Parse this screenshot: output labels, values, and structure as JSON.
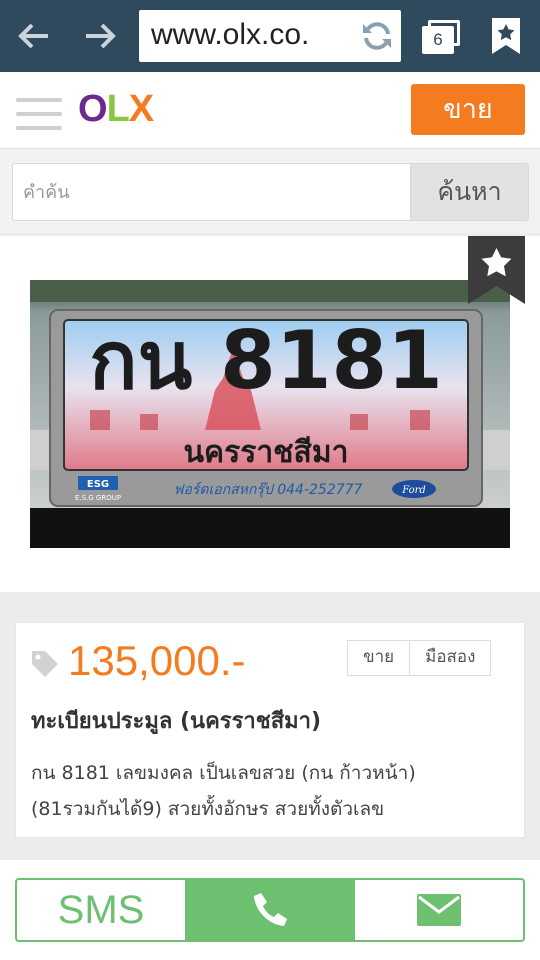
{
  "browser": {
    "url": "www.olx.co.",
    "tab_count": "6",
    "icons": [
      "back-arrow-icon",
      "forward-arrow-icon",
      "reload-icon",
      "tabs-icon",
      "bookmark-star-icon"
    ]
  },
  "header": {
    "logo": {
      "o": "O",
      "l": "L",
      "x": "X"
    },
    "sell_label": "ขาย"
  },
  "search": {
    "placeholder": "คำค้น",
    "button_label": "ค้นหา"
  },
  "listing": {
    "photo": {
      "plate_text": "กน 8181",
      "plate_province": "นครราชสีมา",
      "frame_dealer": "ฟอร์ดเอกสหกรุ๊ป 044-252777",
      "frame_tag": "ESG",
      "frame_tag_sub": "E.S.G GROUP",
      "frame_brand": "Ford"
    },
    "price": "135,000.-",
    "badges": [
      "ขาย",
      "มือสอง"
    ],
    "title": "ทะเบียนประมูล (นครราชสีมา)",
    "description_lines": [
      "กน 8181 เลขมงคล เป็นเลขสวย (กน ก้าวหน้า)",
      "(81รวมกันได้9) สวยทั้งอักษร สวยทั้งตัวเลข"
    ]
  },
  "actions": {
    "sms_label": "SMS"
  },
  "colors": {
    "browser_bar": "#2e4a5c",
    "accent_orange": "#f47b20",
    "accent_green": "#6cc070",
    "logo_purple": "#6c2a8c",
    "logo_green": "#8cc63e"
  }
}
